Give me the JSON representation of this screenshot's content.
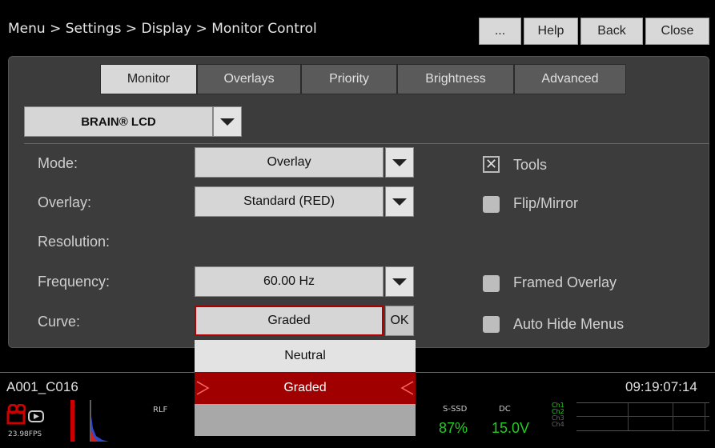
{
  "header": {
    "breadcrumb": "Menu > Settings > Display > Monitor Control",
    "buttons": [
      "...",
      "Help",
      "Back",
      "Close"
    ]
  },
  "tabs": [
    "Monitor",
    "Overlays",
    "Priority",
    "Brightness",
    "Advanced"
  ],
  "active_tab": "Monitor",
  "device_select": {
    "value": "BRAIN® LCD"
  },
  "form": {
    "mode": {
      "label": "Mode:",
      "value": "Overlay"
    },
    "overlay": {
      "label": "Overlay:",
      "value": "Standard (RED)"
    },
    "resolution": {
      "label": "Resolution:"
    },
    "frequency": {
      "label": "Frequency:",
      "value": "60.00 Hz"
    },
    "curve": {
      "label": "Curve:",
      "value": "Graded",
      "ok_label": "OK"
    }
  },
  "checkboxes": [
    {
      "label": "Tools",
      "checked": true
    },
    {
      "label": "Flip/Mirror",
      "checked": false
    },
    {
      "label": "Framed Overlay",
      "checked": false
    },
    {
      "label": "Auto Hide Menus",
      "checked": false
    }
  ],
  "curve_options": [
    "Neutral",
    "Graded",
    ""
  ],
  "curve_selected": "Graded",
  "status": {
    "clip_name": "A001_C016",
    "timecode": "09:19:07:14",
    "fps": "23.98FPS",
    "rlf": "RLF",
    "media_label": "S-SSD",
    "media_value": "87%",
    "dc_label": "DC",
    "dc_value": "15.0V",
    "channels": [
      "Ch1",
      "Ch2",
      "Ch3",
      "Ch4"
    ],
    "accent_red": "#cc0000",
    "accent_green": "#22cc22"
  }
}
